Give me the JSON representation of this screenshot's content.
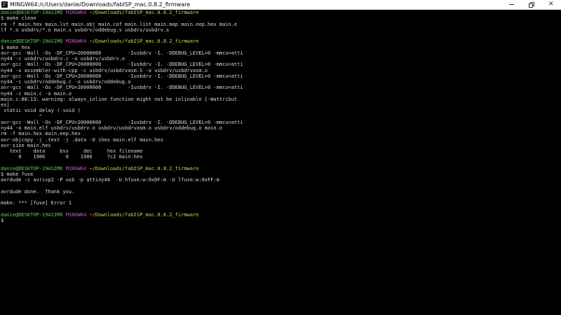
{
  "window": {
    "title": "MINGW64:/c/Users/danie/Downloads/fabISP_mac.0.8.2_firmware",
    "minimize": "—",
    "close": "✕"
  },
  "prompt": {
    "user_host": "danie@DESKTOP-19ASIMO",
    "shell": "MINGW64",
    "path": "~/Downloads/fabISP_mac.0.8.2_firmware"
  },
  "terminal": {
    "lines": [
      {
        "prompt": true
      },
      {
        "text": "$ make clean"
      },
      {
        "text": "rm -f main.hex main.lst main.obj main.cof main.list main.map main.eep.hex main.e"
      },
      {
        "text": "lf *.o usbdrv/*.o main.s usbdrv/oddebug.s usbdrv/usbdrv.s"
      },
      {
        "text": ""
      },
      {
        "prompt": true
      },
      {
        "text": "$ make hex"
      },
      {
        "text": "avr-gcc -Wall -Os -DF_CPU=20000000         -Iusbdrv -I. -DDEBUG_LEVEL=0 -mmcu=atti"
      },
      {
        "text": "ny44 -c usbdrv/usbdrv.c -o usbdrv/usbdrv.o"
      },
      {
        "text": "avr-gcc -Wall -Os -DF_CPU=20000000         -Iusbdrv -I. -DDEBUG_LEVEL=0 -mmcu=atti"
      },
      {
        "text": "ny44 -x assembler-with-cpp -c usbdrv/usbdrvasm.S -o usbdrv/usbdrvasm.o"
      },
      {
        "text": "avr-gcc -Wall -Os -DF_CPU=20000000         -Iusbdrv -I. -DDEBUG_LEVEL=0 -mmcu=atti"
      },
      {
        "text": "ny44 -c usbdrv/oddebug.c -o usbdrv/oddebug.o"
      },
      {
        "text": "avr-gcc -Wall -Os -DF_CPU=20000000         -Iusbdrv -I. -DDEBUG_LEVEL=0 -mmcu=atti"
      },
      {
        "text": "ny44 -c main.c -o main.o"
      },
      {
        "text": "main.c:88:13: warning: always_inline function might not be inlinable [-Wattribut"
      },
      {
        "text": "es]"
      },
      {
        "text": " static void delay ( void )"
      },
      {
        "text": "             ^"
      },
      {
        "text": "avr-gcc -Wall -Os -DF_CPU=20000000         -Iusbdrv -I. -DDEBUG_LEVEL=0 -mmcu=atti"
      },
      {
        "text": "ny44 -o main.elf usbdrv/usbdrv.o usbdrv/usbdrvasm.o usbdrv/oddebug.o main.o"
      },
      {
        "text": "rm -f main.hex main.eep.hex"
      },
      {
        "text": "avr-objcopy -j .text -j .data -O ihex main.elf main.hex"
      },
      {
        "text": "avr-size main.hex"
      },
      {
        "text": "   text    data     bss     dec     hex filename"
      },
      {
        "text": "      0    1986       0    1986     7c2 main.hex"
      },
      {
        "text": ""
      },
      {
        "prompt": true
      },
      {
        "text": "$ make fuse"
      },
      {
        "text": "avrdude -c avrisp2 -P usb -p attiny44  -U hfuse:w:0xDF:m -U lfuse:w:0xFF:m"
      },
      {
        "text": ""
      },
      {
        "text": "avrdude done.  Thank you."
      },
      {
        "text": ""
      },
      {
        "text": "make: *** [fuse] Error 1"
      },
      {
        "text": ""
      },
      {
        "prompt": true
      },
      {
        "text": "$"
      }
    ]
  }
}
